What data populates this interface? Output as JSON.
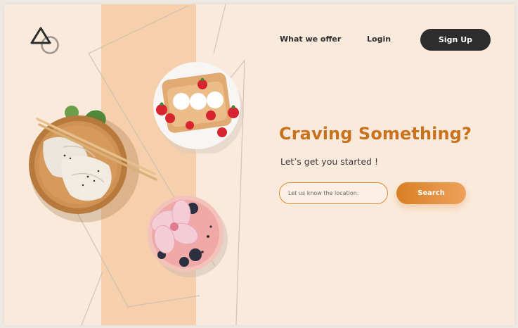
{
  "nav": {
    "links": [
      {
        "label": "What we offer"
      },
      {
        "label": "Login"
      }
    ],
    "signup_label": "Sign Up"
  },
  "hero": {
    "headline": "Craving Something?",
    "subheadline": "Let’s get you started !",
    "location_placeholder": "Let us know the location.",
    "search_label": "Search"
  },
  "images": [
    {
      "name": "dumplings-bowl"
    },
    {
      "name": "crepes-plate"
    },
    {
      "name": "berry-smoothie-bowl"
    }
  ],
  "colors": {
    "background": "#faeadc",
    "stripe": "#f6d0ad",
    "accent": "#d87f24",
    "dark": "#2d2d2d"
  }
}
